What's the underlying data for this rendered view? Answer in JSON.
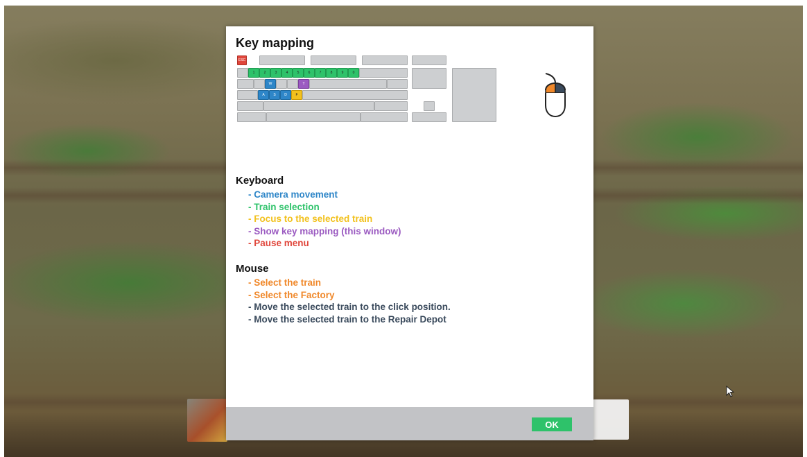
{
  "dialog": {
    "title": "Key mapping"
  },
  "keyboard": {
    "esc_key": "ESC",
    "number_keys": [
      "1",
      "2",
      "3",
      "4",
      "5",
      "6",
      "7",
      "8",
      "9",
      "0"
    ],
    "w_key": "W",
    "t_key": "T",
    "a_key": "A",
    "s_key": "S",
    "d_key": "D",
    "f_key": "F"
  },
  "mouse_icon": {
    "left_button_color": "#f0882a",
    "right_button_color": "#3a4a5c"
  },
  "keyboard_section": {
    "heading": "Keyboard",
    "items": [
      {
        "text": "- Camera movement",
        "color": "#2e86c8"
      },
      {
        "text": "- Train selection",
        "color": "#2ec26a"
      },
      {
        "text": "- Focus to the selected train",
        "color": "#f2c11d"
      },
      {
        "text": "- Show key mapping (this window)",
        "color": "#9b5bc1"
      },
      {
        "text": "- Pause menu",
        "color": "#e0463b"
      }
    ]
  },
  "mouse_section": {
    "heading": "Mouse",
    "items": [
      {
        "text": "- Select the train",
        "color": "#f0882a"
      },
      {
        "text": "- Select the Factory",
        "color": "#f0882a"
      },
      {
        "text": "- Move the selected train to the click position.",
        "color": "#3a4a5c"
      },
      {
        "text": "- Move the selected train to the Repair Depot",
        "color": "#3a4a5c"
      }
    ]
  },
  "footer": {
    "ok_label": "OK"
  },
  "colors": {
    "accent_green": "#2ec26a",
    "footer_gray": "#c2c3c6"
  }
}
